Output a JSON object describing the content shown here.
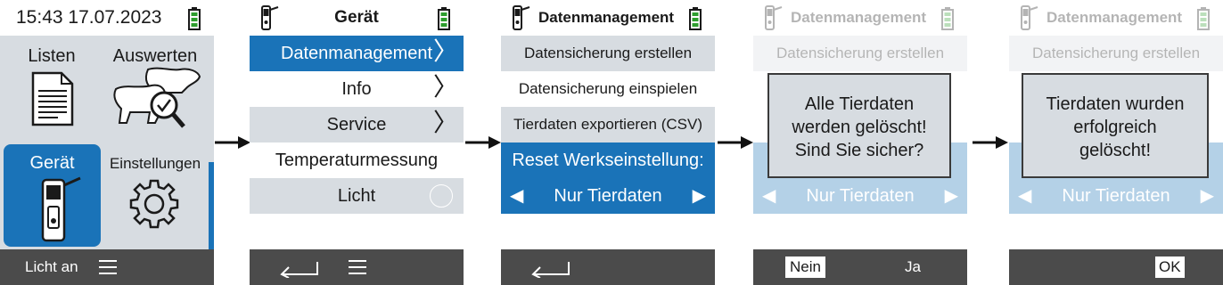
{
  "screen1": {
    "time": "15:43 17.07.2023",
    "tiles": [
      "Listen",
      "Auswerten",
      "Gerät",
      "Einstellungen"
    ],
    "footer_label": "Licht an",
    "menu_icon": "menu-icon"
  },
  "screen2": {
    "title": "Gerät",
    "items": [
      "Datenmanagement",
      "Info",
      "Service",
      "Temperaturmessung",
      "Licht"
    ],
    "chevron": "〉"
  },
  "screen3": {
    "title": "Datenmanagement",
    "items": [
      "Datensicherung erstellen",
      "Datensicherung einspielen",
      "Tierdaten exportieren (CSV)"
    ],
    "reset_label": "Reset Werkseinstellung:",
    "reset_value": "Nur Tierdaten",
    "left": "◀",
    "right": "▶"
  },
  "screen4": {
    "title": "Datenmanagement",
    "bg_item": "Datensicherung erstellen",
    "bg_value": "Nur Tierdaten",
    "dialog": [
      "Alle Tierdaten",
      "werden gelöscht!",
      "Sind Sie sicher?"
    ],
    "btn_no": "Nein",
    "btn_yes": "Ja"
  },
  "screen5": {
    "title": "Datenmanagement",
    "bg_item": "Datensicherung erstellen",
    "bg_value": "Nur Tierdaten",
    "dialog": [
      "Tierdaten wurden",
      "erfolgreich",
      "gelöscht!"
    ],
    "btn_ok": "OK"
  },
  "colors": {
    "accent": "#1a73b8",
    "panel": "#d7dce1",
    "footer": "#4b4b4b",
    "battery": "#2e9e2e"
  }
}
